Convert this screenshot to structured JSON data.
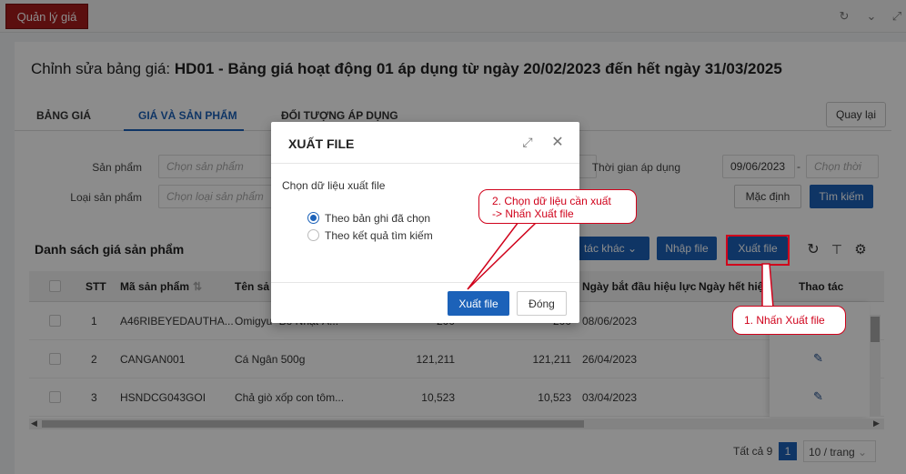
{
  "app": {
    "tab_label": "Quản lý giá"
  },
  "page": {
    "title_prefix": "Chỉnh sửa bảng giá: ",
    "title_bold": "HD01 - Bảng giá hoạt động 01 áp dụng từ ngày 20/02/2023 đến hết ngày 31/03/2025",
    "back_label": "Quay lại"
  },
  "tabs": [
    {
      "label": "BẢNG GIÁ"
    },
    {
      "label": "GIÁ VÀ SẢN PHẨM"
    },
    {
      "label": "ĐỐI TƯỢNG ÁP DỤNG"
    }
  ],
  "filters": {
    "product_label": "Sản phẩm",
    "product_placeholder": "Chọn sản phẩm",
    "category_label": "Loại sản phẩm",
    "category_placeholder": "Chọn loại sản phẩm",
    "time_label": "Thời gian áp dụng",
    "date_from": "09/06/2023",
    "date_sep": "-",
    "date_to_placeholder": "Chọn thời",
    "default_button": "Mặc định",
    "search_button": "Tìm kiếm"
  },
  "list": {
    "title": "Danh sách giá sản phẩm",
    "other_actions": "Thao tác khác",
    "other_actions_visible": "tác khác",
    "import_button": "Nhập file",
    "export_button": "Xuất file"
  },
  "table": {
    "headers": {
      "stt": "STT",
      "code": "Mã sản phẩm",
      "name": "Tên sả",
      "start": "Ngày bắt đầu hiệu lực",
      "end": "Ngày hết hiệ",
      "actions": "Thao tác"
    },
    "rows": [
      {
        "stt": "1",
        "code": "A46RIBEYEDAUTHA...",
        "name": "Omigyu -Bò Nhật-A...",
        "price1": "200",
        "price2": "200",
        "date": "08/06/2023"
      },
      {
        "stt": "2",
        "code": "CANGAN001",
        "name": "Cá Ngân 500g",
        "price1": "121,211",
        "price2": "121,211",
        "date": "26/04/2023"
      },
      {
        "stt": "3",
        "code": "HSNDCG043GOI",
        "name": "Chả giò xốp con tôm...",
        "price1": "10,523",
        "price2": "10,523",
        "date": "03/04/2023"
      }
    ]
  },
  "pagination": {
    "total": "Tất cả 9",
    "page": "1",
    "page_size": "10 / trang"
  },
  "modal": {
    "title": "XUẤT FILE",
    "label": "Chọn dữ liệu xuất file",
    "option_selected": "Theo bản ghi đã chọn",
    "option_search": "Theo kết quả tìm kiếm",
    "export_button": "Xuất file",
    "close_button": "Đóng"
  },
  "annotations": {
    "callout_2_line1": "2. Chọn dữ liệu cần xuất",
    "callout_2_line2": "-> Nhấn Xuất file",
    "callout_1": "1. Nhấn Xuất file",
    "color": "#d0021b"
  },
  "colors": {
    "brand_red": "#a61c1c",
    "primary_blue": "#1c62b9"
  }
}
